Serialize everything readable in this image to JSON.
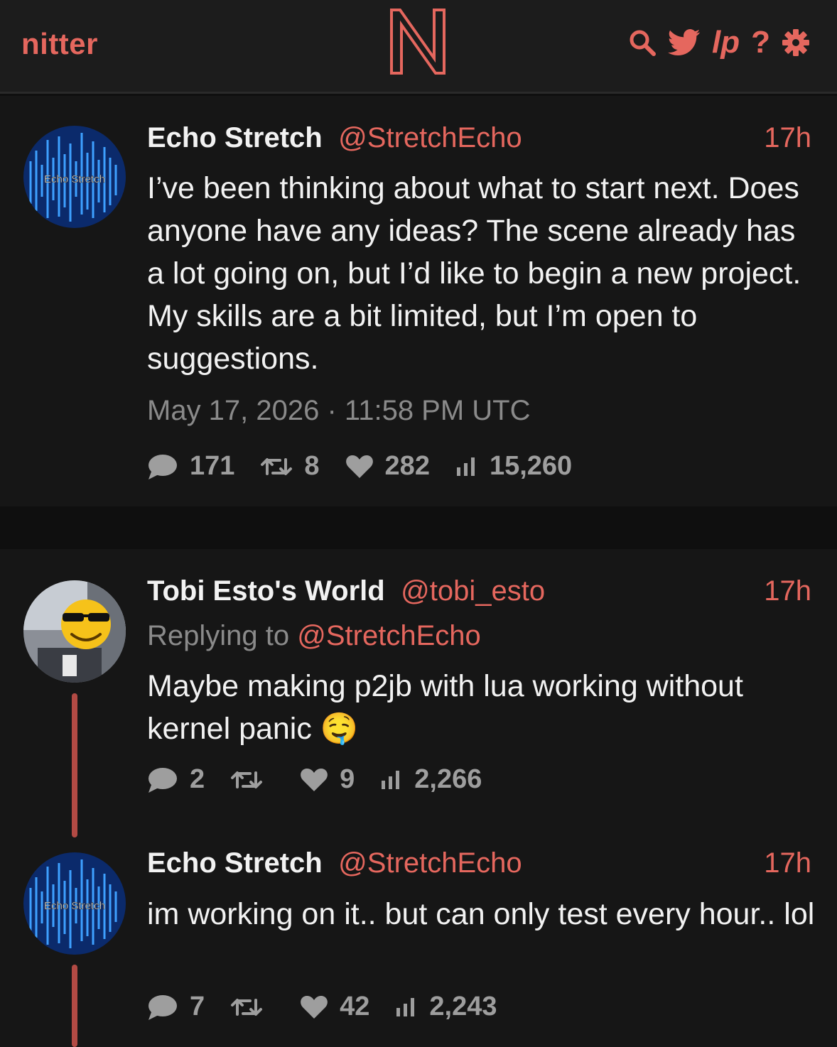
{
  "nav": {
    "brand": "nitter",
    "logo_letter": "N",
    "icons": [
      "search-icon",
      "twitter-bird-icon",
      "lp-icon",
      "help-icon",
      "settings-gear-icon"
    ],
    "lp_label": "lp",
    "help_label": "?"
  },
  "colors": {
    "accent": "#e5675e",
    "background": "#0f0f0f",
    "card": "#161616",
    "navbar": "#1c1c1c",
    "thread_line": "#b24a44",
    "muted": "#8a8a8a"
  },
  "main_tweet": {
    "avatar_text": "Echo Stretch",
    "fullname": "Echo Stretch",
    "username": "@StretchEcho",
    "time": "17h",
    "body": "I’ve been thinking about what to start next. Does anyone have any ideas? The scene already has a lot going on, but I’d like to begin a new project. My skills are a bit limited, but I’m open to suggestions.",
    "date": "May 17, 2026 · 11:58 PM UTC",
    "stats": {
      "replies": "171",
      "retweets": "8",
      "likes": "282",
      "views": "15,260"
    }
  },
  "replies": [
    {
      "fullname": "Tobi Esto's World",
      "username": "@tobi_esto",
      "time": "17h",
      "replying_prefix": "Replying to",
      "replying_to": "@StretchEcho",
      "body": "Maybe making p2jb with lua working without kernel panic",
      "emoji": "🤤",
      "stats": {
        "replies": "2",
        "retweets": "",
        "likes": "9",
        "views": "2,266"
      }
    },
    {
      "avatar_text": "Echo Stretch",
      "fullname": "Echo Stretch",
      "username": "@StretchEcho",
      "time": "17h",
      "body": "im working on it.. but can only test every hour.. lol",
      "stats": {
        "replies": "7",
        "retweets": "",
        "likes": "42",
        "views": "2,243"
      }
    }
  ]
}
